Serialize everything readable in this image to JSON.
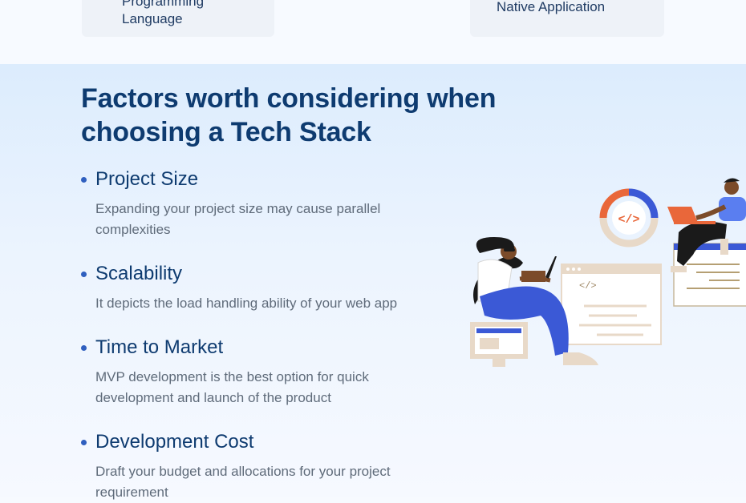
{
  "top_cards": {
    "left_label": "Programming\nLanguage",
    "right_label": "Native Application"
  },
  "section": {
    "title": "Factors worth considering when choosing a Tech Stack",
    "factors": [
      {
        "title": "Project Size",
        "description": "Expanding your project size may cause parallel complexities"
      },
      {
        "title": "Scalability",
        "description": "It depicts the load handling ability of your web app"
      },
      {
        "title": "Time to Market",
        "description": "MVP development is the best option for quick development and launch of the product"
      },
      {
        "title": "Development Cost",
        "description": "Draft your budget and allocations for your project requirement"
      }
    ]
  },
  "illustration": {
    "icons": [
      "code-icon",
      "laptop-icon",
      "monitor-icon"
    ],
    "code_symbol": "</>",
    "colors": {
      "orange": "#e9673a",
      "blue": "#3b59d6",
      "beige": "#e8d9c8",
      "dark": "#1a1a1a",
      "skin": "#7b4b2a"
    }
  },
  "colors": {
    "heading": "#0e3b70",
    "body_text": "#5f6b7a",
    "bullet": "#2f5fbf",
    "section_bg_top": "#dcecfd"
  }
}
